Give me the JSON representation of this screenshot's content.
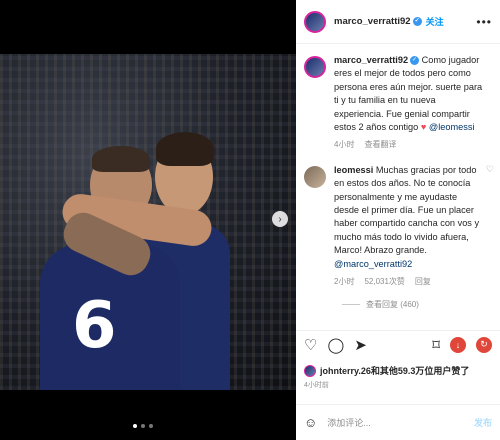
{
  "post": {
    "carousel_next": "›",
    "number_on_shirt": "6"
  },
  "header": {
    "username": "marco_verratti92",
    "follow_label": "关注",
    "more": "•••"
  },
  "caption": {
    "username": "marco_verratti92",
    "text": "Como jugador eres el mejor de todos pero como persona eres aún mejor. suerte para ti y tu familia en tu nueva experiencia. Fue genial compartir estos 2 años contigo",
    "mention": "@leomessi",
    "time": "4小时",
    "translate": "查看翻译"
  },
  "comment": {
    "username": "leomessi",
    "text": "Muchas gracias por todo en estos dos años. No te conocía personalmente y me ayudaste desde el primer día. Fue un placer haber compartido cancha con vos y mucho más todo lo vivido afuera, Marco! Abrazo grande.",
    "mention": "@marco_verratti92",
    "time": "2小时",
    "likes": "52,031次赞",
    "reply": "回复",
    "view_replies": "查看回复 (460)"
  },
  "likes_line": {
    "user": "johnterry.26",
    "rest": "和其他59.3万位用户赞了"
  },
  "post_time": "4小时前",
  "add_comment": {
    "placeholder": "添加评论...",
    "post_label": "发布"
  }
}
